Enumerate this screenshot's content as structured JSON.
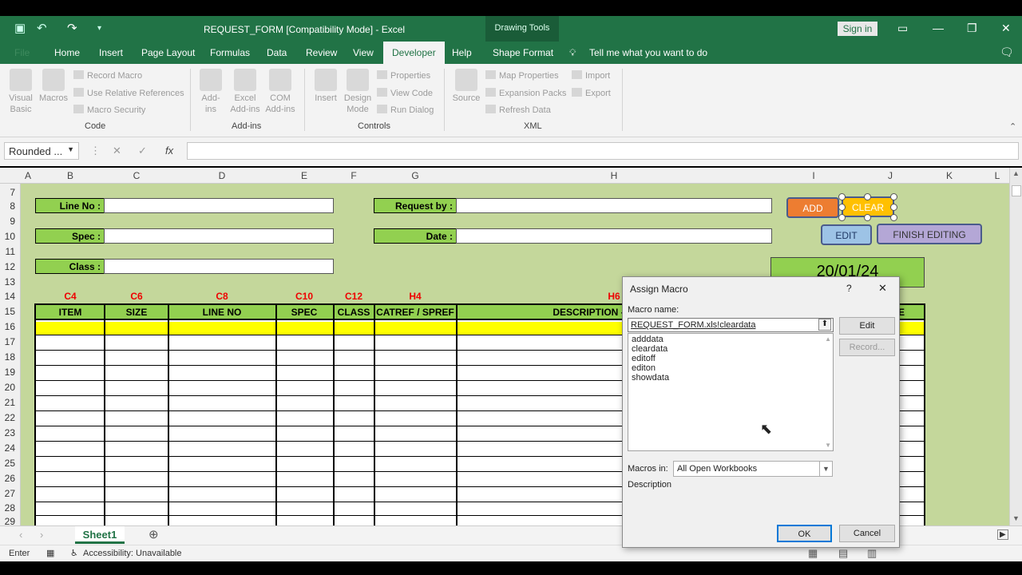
{
  "window": {
    "title": "REQUEST_FORM  [Compatibility Mode]  -  Excel",
    "drawing_tools": "Drawing Tools",
    "sign_in": "Sign in"
  },
  "tabs": [
    "File",
    "Home",
    "Insert",
    "Page Layout",
    "Formulas",
    "Data",
    "Review",
    "View",
    "Developer",
    "Help",
    "Shape Format"
  ],
  "tell_me": "Tell me what you want to do",
  "ribbon": {
    "visual_basic": "Visual Basic",
    "macros": "Macros",
    "record_macro": "Record Macro",
    "use_relative": "Use Relative References",
    "macro_security": "Macro Security",
    "code_label": "Code",
    "add_ins": "Add-ins",
    "excel_add_ins": "Excel Add-ins",
    "com_add_ins": "COM Add-ins",
    "add_ins_label": "Add-ins",
    "insert": "Insert",
    "design_mode": "Design Mode",
    "properties": "Properties",
    "view_code": "View Code",
    "run_dialog": "Run Dialog",
    "controls_label": "Controls",
    "source": "Source",
    "map_properties": "Map Properties",
    "expansion_packs": "Expansion Packs",
    "refresh_data": "Refresh Data",
    "import": "Import",
    "export": "Export",
    "xml_label": "XML"
  },
  "name_box": "Rounded ...",
  "fx": "fx",
  "columns": [
    "A",
    "B",
    "C",
    "D",
    "E",
    "F",
    "G",
    "H",
    "I",
    "J",
    "K",
    "L"
  ],
  "rows": [
    "7",
    "8",
    "9",
    "10",
    "11",
    "12",
    "13",
    "14",
    "15",
    "16",
    "17",
    "18",
    "19",
    "20",
    "21",
    "22",
    "23",
    "24",
    "25",
    "26",
    "27",
    "28",
    "29"
  ],
  "form": {
    "line_no": "Line No :",
    "spec": "Spec :",
    "class": "Class :",
    "request_by": "Request by :",
    "date": "Date :",
    "date_value": "20/01/24",
    "add": "ADD",
    "clear": "CLEAR",
    "edit": "EDIT",
    "finish_editing": "FINISH EDITING"
  },
  "refs": [
    "C4",
    "C6",
    "C8",
    "C10",
    "C12",
    "H4",
    "H6"
  ],
  "table_headers": [
    "ITEM",
    "SIZE",
    "LINE NO",
    "SPEC",
    "CLASS",
    "CATREF / SPREF",
    "DESCRIPTION -",
    "E"
  ],
  "sheet_tab": "Sheet1",
  "status": {
    "mode": "Enter",
    "accessibility": "Accessibility: Unavailable"
  },
  "dialog": {
    "title": "Assign Macro",
    "help": "?",
    "close": "✕",
    "macro_name_label": "Macro name:",
    "macro_name_value": "REQUEST_FORM.xls!cleardata",
    "macros": [
      "adddata",
      "cleardata",
      "editoff",
      "editon",
      "showdata"
    ],
    "edit": "Edit",
    "record": "Record...",
    "macros_in_label": "Macros in:",
    "macros_in_value": "All Open Workbooks",
    "description_label": "Description",
    "ok": "OK",
    "cancel": "Cancel"
  }
}
